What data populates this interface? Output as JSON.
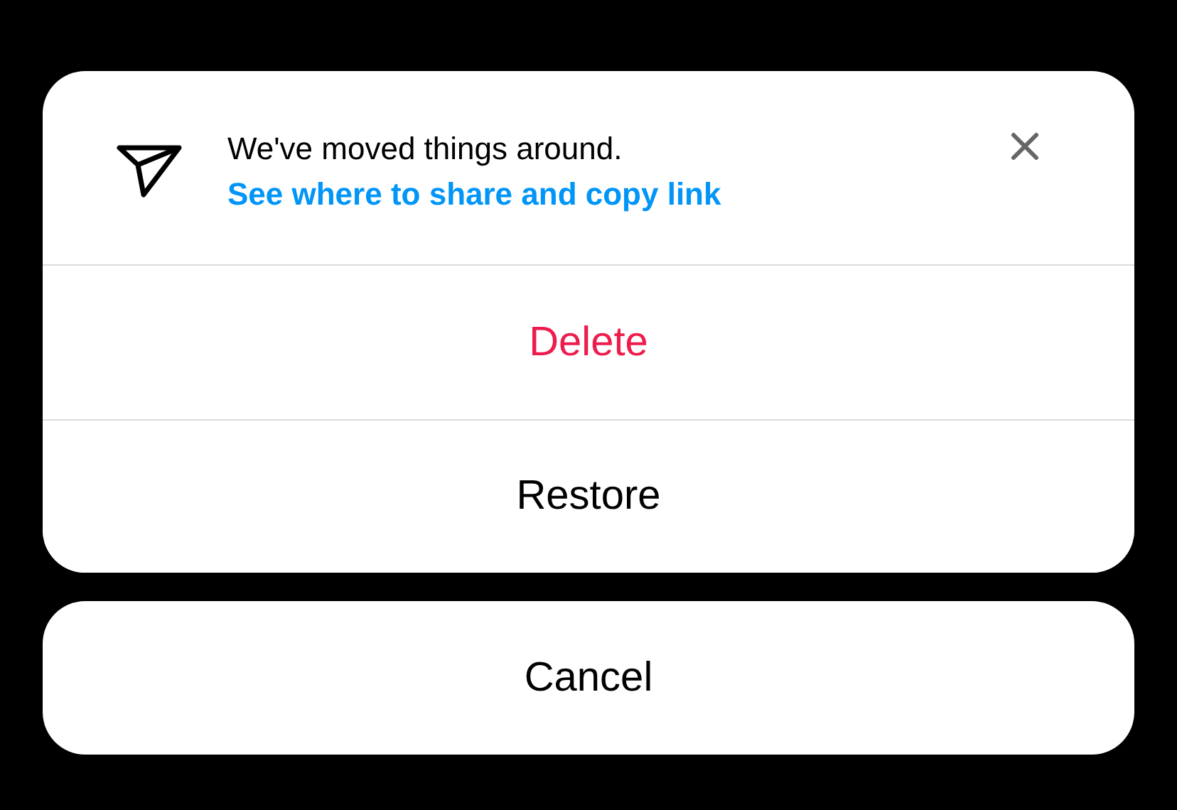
{
  "notice": {
    "message": "We've moved things around.",
    "link": "See where to share and copy link"
  },
  "actions": [
    {
      "label": "Delete",
      "kind": "destructive"
    },
    {
      "label": "Restore",
      "kind": "default"
    }
  ],
  "cancel": {
    "label": "Cancel"
  }
}
